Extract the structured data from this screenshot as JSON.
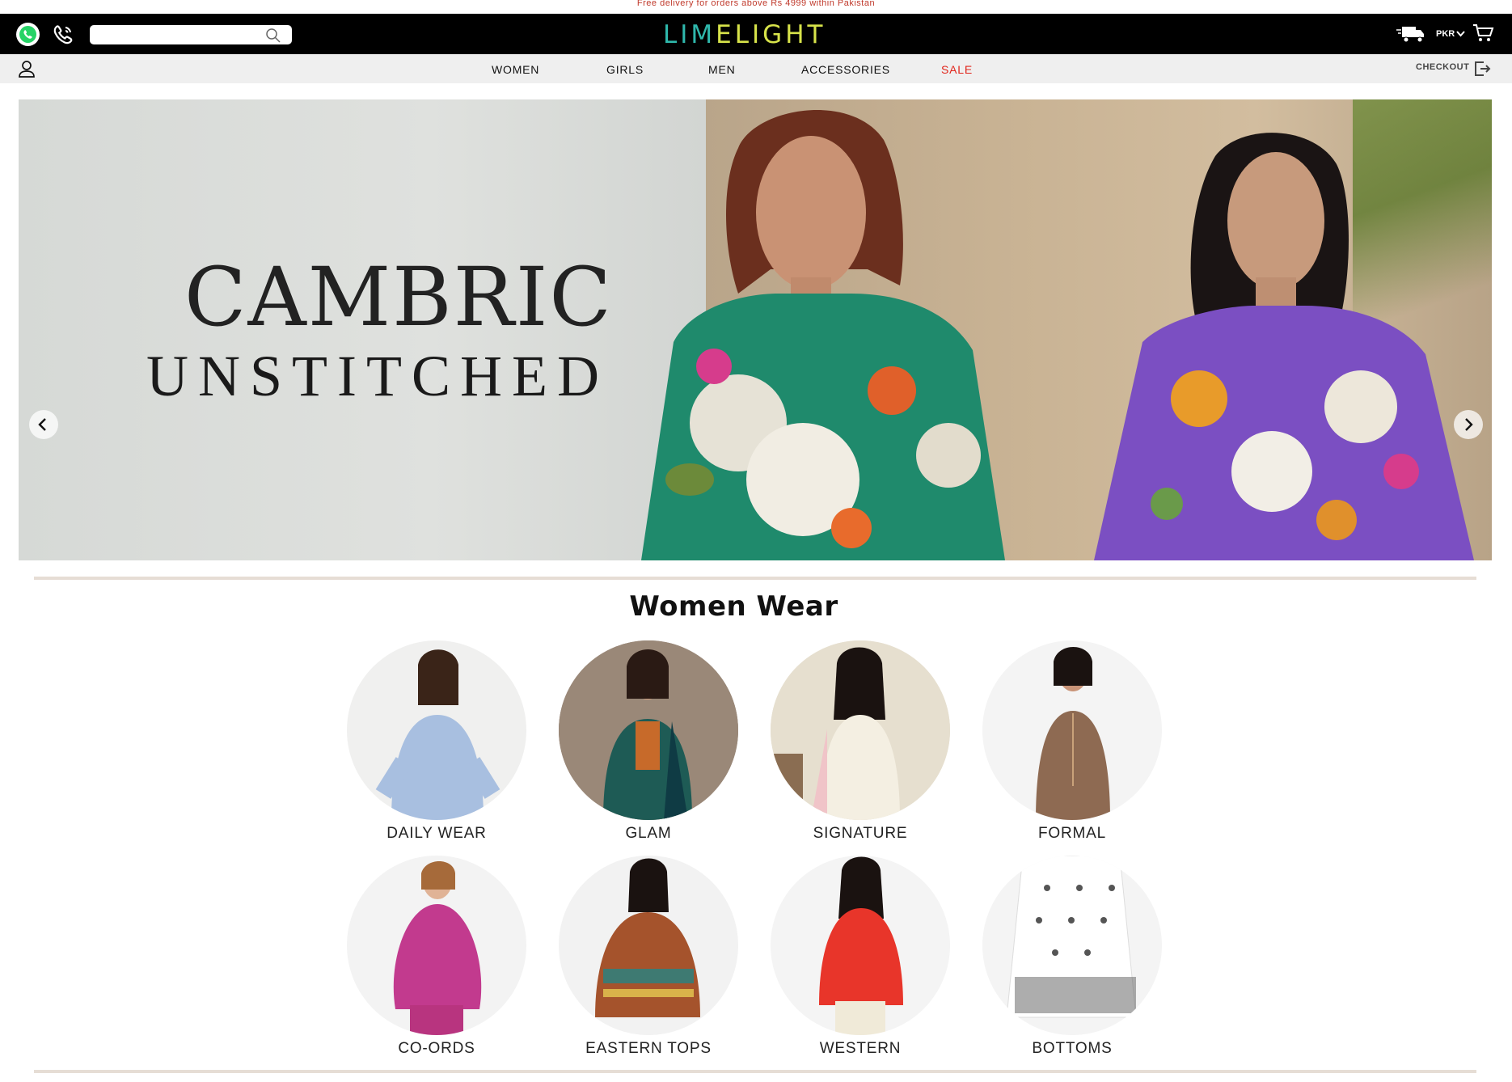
{
  "promo": {
    "text": "Free delivery for orders above Rs 4999 within Pakistan"
  },
  "header": {
    "search_placeholder": "",
    "logo_part1": "LIM",
    "logo_part2": "ELIGHT",
    "currency": "PKR",
    "icons": [
      "whatsapp-icon",
      "phone-icon",
      "search-icon",
      "truck-icon",
      "chevron-down-icon",
      "cart-icon"
    ]
  },
  "nav": {
    "items": [
      {
        "label": "WOMEN"
      },
      {
        "label": "GIRLS"
      },
      {
        "label": "MEN"
      },
      {
        "label": "ACCESSORIES"
      },
      {
        "label": "SALE",
        "color": "#e1251b"
      }
    ],
    "checkout": "CHECKOUT"
  },
  "hero": {
    "line1": "CAMBRIC",
    "line2": "UNSTITCHED"
  },
  "section": {
    "title": "Women Wear",
    "categories": [
      {
        "label": "DAILY WEAR"
      },
      {
        "label": "GLAM"
      },
      {
        "label": "SIGNATURE"
      },
      {
        "label": "FORMAL"
      },
      {
        "label": "CO-ORDS"
      },
      {
        "label": "EASTERN TOPS"
      },
      {
        "label": "WESTERN"
      },
      {
        "label": "BOTTOMS"
      }
    ]
  },
  "colors": {
    "brand_teal": "#2fb8ac",
    "brand_lime": "#d7e34a",
    "sale_red": "#e1251b",
    "divider": "#e6ddd5"
  }
}
